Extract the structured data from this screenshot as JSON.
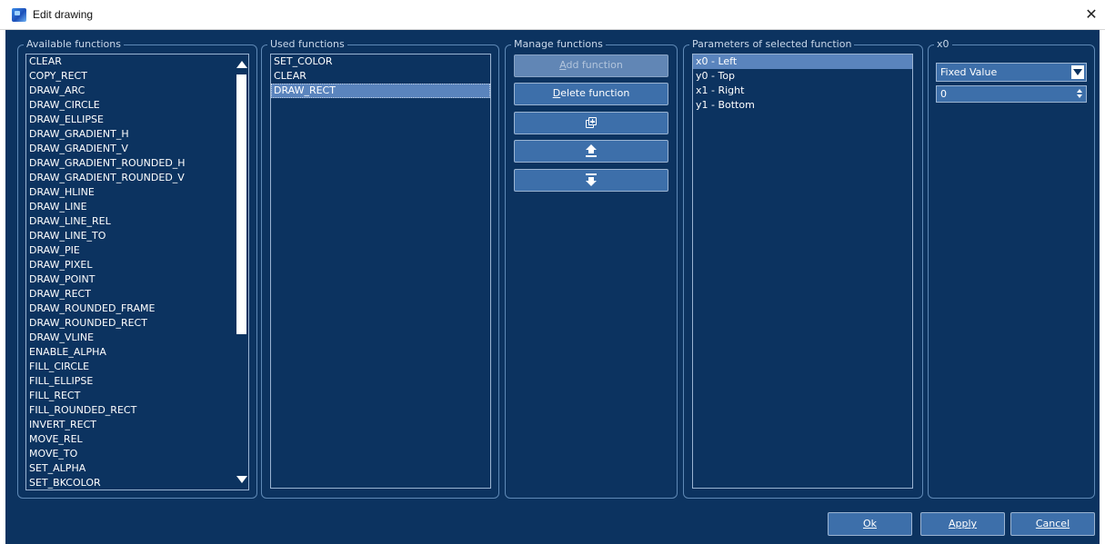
{
  "window": {
    "title": "Edit drawing",
    "close_glyph": "✕"
  },
  "available": {
    "legend": "Available functions",
    "items": [
      "CLEAR",
      "COPY_RECT",
      "DRAW_ARC",
      "DRAW_CIRCLE",
      "DRAW_ELLIPSE",
      "DRAW_GRADIENT_H",
      "DRAW_GRADIENT_V",
      "DRAW_GRADIENT_ROUNDED_H",
      "DRAW_GRADIENT_ROUNDED_V",
      "DRAW_HLINE",
      "DRAW_LINE",
      "DRAW_LINE_REL",
      "DRAW_LINE_TO",
      "DRAW_PIE",
      "DRAW_PIXEL",
      "DRAW_POINT",
      "DRAW_RECT",
      "DRAW_ROUNDED_FRAME",
      "DRAW_ROUNDED_RECT",
      "DRAW_VLINE",
      "ENABLE_ALPHA",
      "FILL_CIRCLE",
      "FILL_ELLIPSE",
      "FILL_RECT",
      "FILL_ROUNDED_RECT",
      "INVERT_RECT",
      "MOVE_REL",
      "MOVE_TO",
      "SET_ALPHA",
      "SET_BKCOLOR"
    ]
  },
  "used": {
    "legend": "Used functions",
    "items": [
      "SET_COLOR",
      "CLEAR",
      "DRAW_RECT"
    ],
    "selected_index": 2
  },
  "manage": {
    "legend": "Manage functions",
    "add_prefix": "A",
    "add_rest": "dd function",
    "delete_prefix": "D",
    "delete_rest": "elete function",
    "duplicate_icon": "duplicate-icon",
    "move_up_icon": "move-up-icon",
    "move_down_icon": "move-down-icon"
  },
  "params": {
    "legend": "Parameters of selected function",
    "items": [
      "x0 - Left",
      "y0 - Top",
      "x1 - Right",
      "y1 - Bottom"
    ],
    "selected_index": 0
  },
  "param_editor": {
    "legend": "x0",
    "mode_value": "Fixed Value",
    "numeric_value": "0"
  },
  "footer": {
    "ok_label": "Ok",
    "apply_label": "Apply",
    "cancel_label": "Cancel"
  },
  "colors": {
    "background": "#0c3360",
    "button": "#3d6faa",
    "selection": "#5a84bd",
    "frame": "#5f89b6"
  }
}
